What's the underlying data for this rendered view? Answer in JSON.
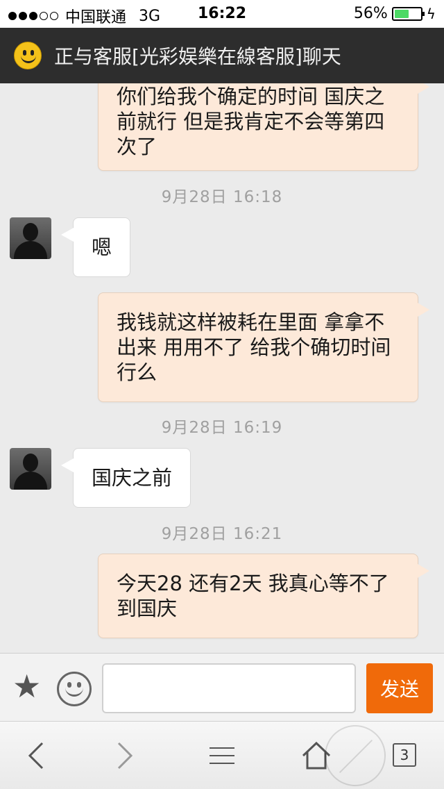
{
  "status_bar": {
    "carrier": "中国联通",
    "network": "3G",
    "time": "16:22",
    "battery_percent": "56%",
    "battery_level": 0.56,
    "signal_bars_filled": 3,
    "signal_bars_total": 5
  },
  "header": {
    "icon": "smiley-icon",
    "title": "正与客服[光彩娱樂在線客服]聊天"
  },
  "messages": [
    {
      "kind": "out",
      "lines": [
        "你们给我个确定的时间 国庆之",
        "前就行 但是我肯定不会等第四",
        "次了"
      ]
    },
    {
      "kind": "timestamp",
      "text": "9月28日 16:18"
    },
    {
      "kind": "in",
      "text": "嗯"
    },
    {
      "kind": "out",
      "lines": [
        "我钱就这样被耗在里面 拿拿不",
        "出来 用用不了 给我个确切时间",
        "行么"
      ]
    },
    {
      "kind": "timestamp",
      "text": "9月28日 16:19"
    },
    {
      "kind": "in",
      "text": "国庆之前"
    },
    {
      "kind": "timestamp",
      "text": "9月28日 16:21"
    },
    {
      "kind": "out",
      "lines": [
        "今天28 还有2天 我真心等不了",
        "到国庆"
      ]
    }
  ],
  "input_bar": {
    "favorite_icon": "star-icon",
    "emoji_icon": "smiley-face-icon",
    "input_value": "",
    "send_label": "发送"
  },
  "browser_toolbar": {
    "back_icon": "chevron-left-icon",
    "forward_icon": "chevron-right-icon",
    "menu_icon": "hamburger-menu-icon",
    "home_icon": "home-icon",
    "tab_count": "3",
    "overlay_icon": "footprint-icon"
  },
  "colors": {
    "header_bg": "#2d2d2d",
    "outgoing_bubble": "#fde9d9",
    "incoming_bubble": "#ffffff",
    "send_button": "#f06a0a",
    "battery_fill": "#4cd964"
  }
}
